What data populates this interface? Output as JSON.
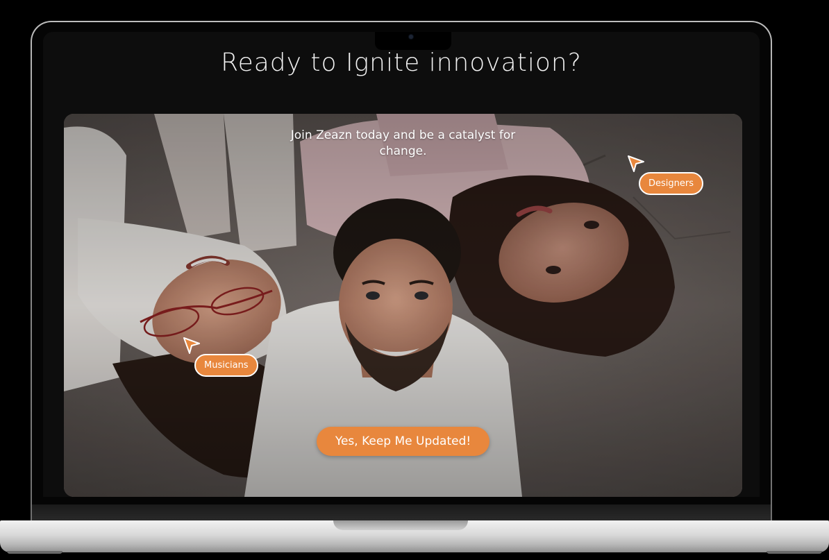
{
  "page": {
    "headline": "Ready to Ignite innovation?",
    "tagline": "Join Zeazn today and be a catalyst for change."
  },
  "hero": {
    "tags": [
      {
        "label": "Designers"
      },
      {
        "label": "Musicians"
      }
    ],
    "cta_label": "Yes, Keep Me Updated!"
  },
  "icons": {
    "cursor": "cursor-arrow-icon",
    "camera": "camera-icon"
  },
  "colors": {
    "accent": "#e8873d",
    "background": "#000000",
    "text": "#ffffff"
  }
}
